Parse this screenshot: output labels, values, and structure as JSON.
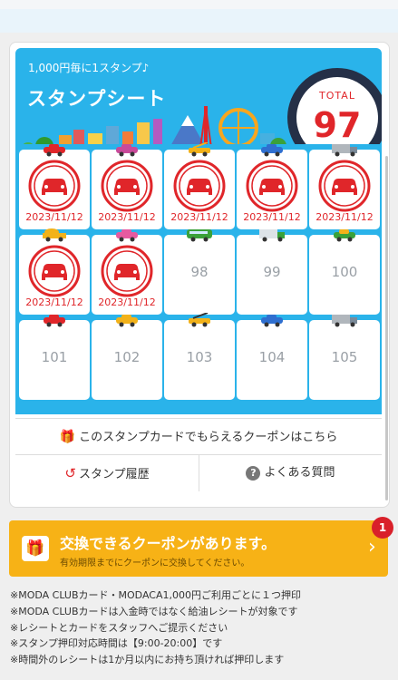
{
  "header": {
    "subtitle": "1,000円毎に1スタンプ♪",
    "title": "スタンプシート",
    "total_label": "TOTAL",
    "total_value": "97"
  },
  "stamps": [
    {
      "date": "2023/11/12",
      "icon": "red-car-icon"
    },
    {
      "date": "2023/11/12",
      "icon": "taxi-icon"
    },
    {
      "date": "2023/11/12",
      "icon": "crane-truck-icon"
    },
    {
      "date": "2023/11/12",
      "icon": "blue-car-icon"
    },
    {
      "date": "2023/11/12",
      "icon": "truck-icon"
    },
    {
      "date": "2023/11/12",
      "icon": "mixer-truck-icon"
    },
    {
      "date": "2023/11/12",
      "icon": "pink-car-icon"
    }
  ],
  "empty_cells": [
    {
      "number": "98",
      "icon": "bus-icon"
    },
    {
      "number": "99",
      "icon": "truck-icon"
    },
    {
      "number": "100",
      "icon": "car-icon"
    },
    {
      "number": "101",
      "icon": "red-car-icon"
    },
    {
      "number": "102",
      "icon": "taxi-icon"
    },
    {
      "number": "103",
      "icon": "crane-truck-icon"
    },
    {
      "number": "104",
      "icon": "blue-car-icon"
    },
    {
      "number": "105",
      "icon": "truck-icon"
    }
  ],
  "links": {
    "coupon": "このスタンプカードでもらえるクーポンはこちら",
    "history": "スタンプ履歴",
    "faq": "よくある質問"
  },
  "banner": {
    "title": "交換できるクーポンがあります。",
    "subtitle": "有効期限までにクーポンに交換してください。",
    "count": "1"
  },
  "notes": [
    "※MODA CLUBカード・MODACA1,000円ご利用ごとに１つ押印",
    "※MODA CLUBカードは入金時ではなく給油レシートが対象です",
    "※レシートとカードをスタッフへご提示ください",
    "※スタンプ押印対応時間は【9:00-20:00】です",
    "※時間外のレシートは1か月以内にお持ち頂ければ押印します"
  ],
  "colors": {
    "header_blue": "#2ab3ea",
    "stamp_red": "#e0262a",
    "banner_yellow": "#f7b216",
    "badge_red": "#d9202a"
  }
}
